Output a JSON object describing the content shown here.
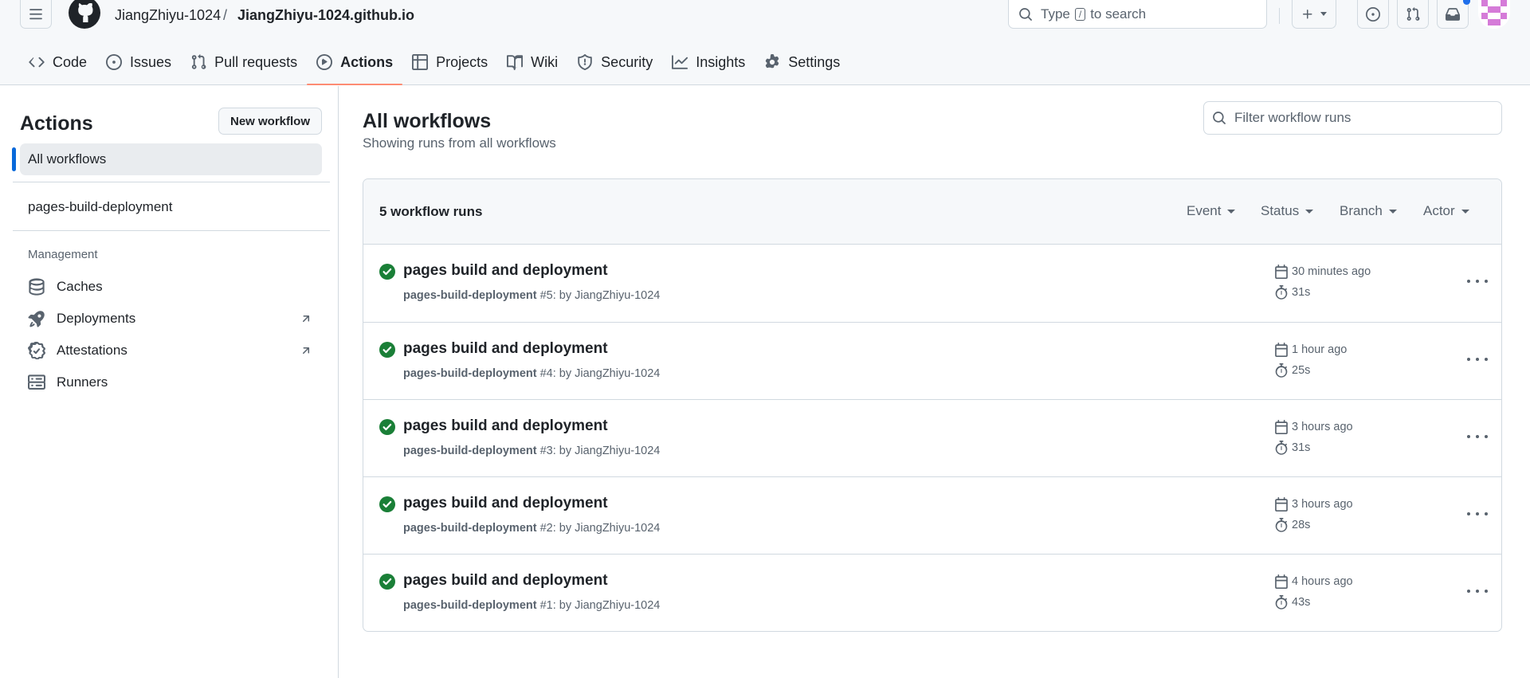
{
  "header": {
    "owner": "JiangZhiyu-1024",
    "separator": "/",
    "repo": "JiangZhiyu-1024.github.io",
    "search": {
      "prefix": "Type",
      "key": "/",
      "suffix": "to search"
    }
  },
  "nav": {
    "tabs": [
      {
        "label": "Code",
        "icon": "code-icon"
      },
      {
        "label": "Issues",
        "icon": "issue-icon"
      },
      {
        "label": "Pull requests",
        "icon": "pull-request-icon"
      },
      {
        "label": "Actions",
        "icon": "play-icon",
        "selected": true
      },
      {
        "label": "Projects",
        "icon": "table-icon"
      },
      {
        "label": "Wiki",
        "icon": "book-icon"
      },
      {
        "label": "Security",
        "icon": "shield-icon"
      },
      {
        "label": "Insights",
        "icon": "graph-icon"
      },
      {
        "label": "Settings",
        "icon": "gear-icon"
      }
    ]
  },
  "sidebar": {
    "title": "Actions",
    "new_workflow": "New workflow",
    "all_workflows": "All workflows",
    "workflows": [
      "pages-build-deployment"
    ],
    "management_heading": "Management",
    "management": [
      {
        "label": "Caches",
        "icon": "database-icon"
      },
      {
        "label": "Deployments",
        "icon": "rocket-icon",
        "external": true
      },
      {
        "label": "Attestations",
        "icon": "verified-icon",
        "external": true
      },
      {
        "label": "Runners",
        "icon": "server-icon"
      }
    ]
  },
  "main": {
    "title": "All workflows",
    "subtitle": "Showing runs from all workflows",
    "filter_placeholder": "Filter workflow runs",
    "runs_count": "5 workflow runs",
    "filters": [
      "Event",
      "Status",
      "Branch",
      "Actor"
    ],
    "runs": [
      {
        "title": "pages build and deployment",
        "workflow": "pages-build-deployment",
        "number": "#5",
        "by": ": by JiangZhiyu-1024",
        "time": "30 minutes ago",
        "duration": "31s"
      },
      {
        "title": "pages build and deployment",
        "workflow": "pages-build-deployment",
        "number": "#4",
        "by": ": by JiangZhiyu-1024",
        "time": "1 hour ago",
        "duration": "25s"
      },
      {
        "title": "pages build and deployment",
        "workflow": "pages-build-deployment",
        "number": "#3",
        "by": ": by JiangZhiyu-1024",
        "time": "3 hours ago",
        "duration": "31s"
      },
      {
        "title": "pages build and deployment",
        "workflow": "pages-build-deployment",
        "number": "#2",
        "by": ": by JiangZhiyu-1024",
        "time": "3 hours ago",
        "duration": "28s"
      },
      {
        "title": "pages build and deployment",
        "workflow": "pages-build-deployment",
        "number": "#1",
        "by": ": by JiangZhiyu-1024",
        "time": "4 hours ago",
        "duration": "43s"
      }
    ]
  },
  "colors": {
    "accent": "#0969da",
    "success": "#1a7f37",
    "tab_underline": "#fd8c73"
  }
}
